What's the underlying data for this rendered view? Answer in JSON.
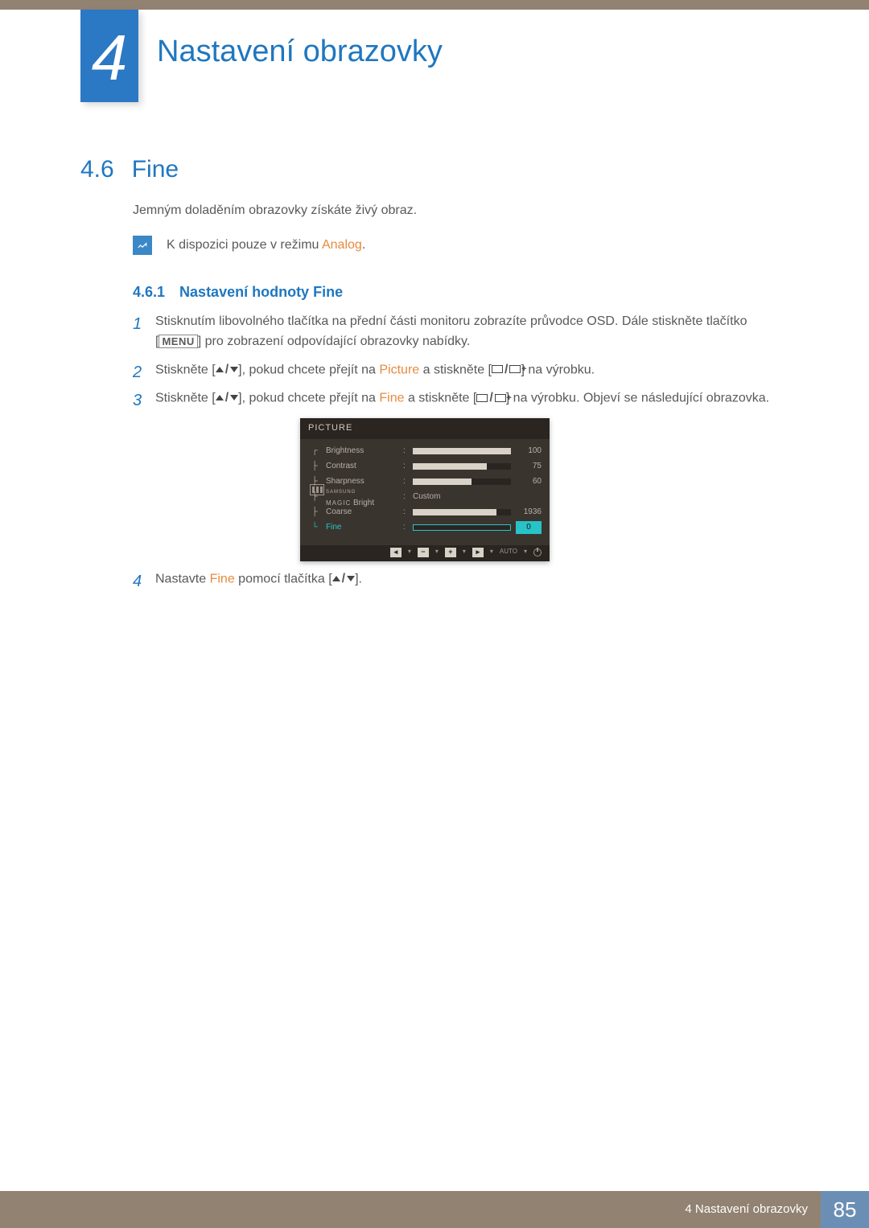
{
  "chapter": {
    "number": "4",
    "title": "Nastavení obrazovky"
  },
  "section": {
    "number": "4.6",
    "title": "Fine"
  },
  "intro": "Jemným doladěním obrazovky získáte živý obraz.",
  "note": {
    "pre": "K dispozici pouze v režimu ",
    "hl": "Analog",
    "post": "."
  },
  "subsection": {
    "number": "4.6.1",
    "title": "Nastavení hodnoty Fine"
  },
  "steps": {
    "s1a": "Stisknutím libovolného tlačítka na přední části monitoru zobrazíte průvodce OSD. Dále stiskněte tlačítko [",
    "s1b": "] pro zobrazení odpovídající obrazovky nabídky.",
    "menu": "MENU",
    "s2a": "Stiskněte [",
    "s2b": "], pokud chcete přejít na ",
    "s2c": " a stiskněte [",
    "s2d": "] na výrobku.",
    "s2hl": "Picture",
    "s3a": "Stiskněte [",
    "s3b": "], pokud chcete přejít na ",
    "s3c": " a stiskněte [",
    "s3d": "] na výrobku. Objeví se následující obrazovka.",
    "s3hl": "Fine",
    "s4a": "Nastavte ",
    "s4hl": "Fine",
    "s4b": " pomocí tlačítka [",
    "s4c": "]."
  },
  "osd": {
    "title": "PICTURE",
    "rows": {
      "brightness": {
        "label": "Brightness",
        "value": "100",
        "fill": 100
      },
      "contrast": {
        "label": "Contrast",
        "value": "75",
        "fill": 75
      },
      "sharpness": {
        "label": "Sharpness",
        "value": "60",
        "fill": 60
      },
      "magic": {
        "brand": "SAMSUNG",
        "sub": "MAGIC",
        "label": "Bright",
        "value": "Custom"
      },
      "coarse": {
        "label": "Coarse",
        "value": "1936"
      },
      "fine": {
        "label": "Fine",
        "value": "0"
      }
    },
    "nav": {
      "auto": "AUTO"
    }
  },
  "footer": {
    "chapter": "4 Nastavení obrazovky",
    "page": "85"
  }
}
